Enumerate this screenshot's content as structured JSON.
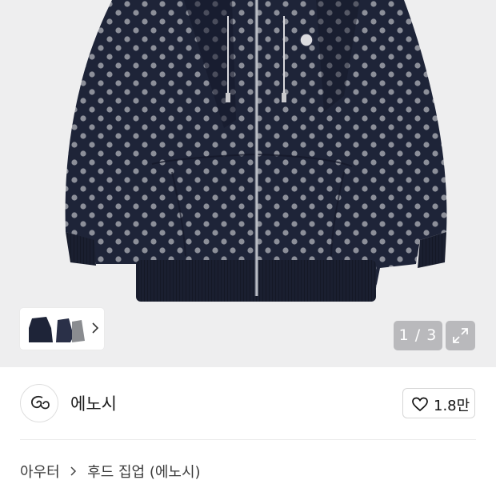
{
  "gallery": {
    "page_current": "1",
    "page_total": "3",
    "page_indicator": "1 / 3",
    "thumbnail_icon": "chevron-right-icon",
    "expand_icon": "expand-icon",
    "product_colors": {
      "fabric": "#1e2438",
      "dot": "#8c8f99",
      "background": "#eeeeef"
    }
  },
  "brand": {
    "name": "에노시",
    "logo": "enosi-logo"
  },
  "like": {
    "icon": "heart-icon",
    "count": "1.8만"
  },
  "breadcrumb": {
    "items": [
      "아우터",
      "후드 집업 (에노시)"
    ],
    "separator_icon": "chevron-right-icon"
  }
}
